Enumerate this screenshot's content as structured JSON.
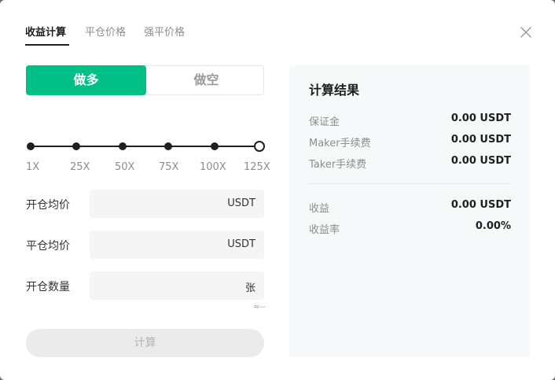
{
  "tabs": [
    {
      "label": "收益计算",
      "active": true
    },
    {
      "label": "平仓价格",
      "active": false
    },
    {
      "label": "强平价格",
      "active": false
    }
  ],
  "close_icon": "close-icon",
  "side": {
    "long_label": "做多",
    "short_label": "做空",
    "selected": "long",
    "accent_color": "#00c087"
  },
  "leverage": {
    "ticks": [
      "1X",
      "25X",
      "50X",
      "75X",
      "100X",
      "125X"
    ],
    "selected": "125X"
  },
  "fields": [
    {
      "label": "开仓均价",
      "value": "",
      "unit": "USDT"
    },
    {
      "label": "平仓均价",
      "value": "",
      "unit": "USDT"
    },
    {
      "label": "开仓数量",
      "value": "",
      "unit": "张"
    }
  ],
  "approx_text": "≈--",
  "calculate_label": "计算",
  "results": {
    "title": "计算结果",
    "rows": [
      {
        "label": "保证金",
        "value": "0.00 USDT"
      },
      {
        "label": "Maker手续费",
        "value": "0.00 USDT"
      },
      {
        "label": "Taker手续费",
        "value": "0.00 USDT"
      },
      {
        "label": "收益",
        "value": "0.00 USDT"
      },
      {
        "label": "收益率",
        "value": "0.00%"
      }
    ]
  }
}
